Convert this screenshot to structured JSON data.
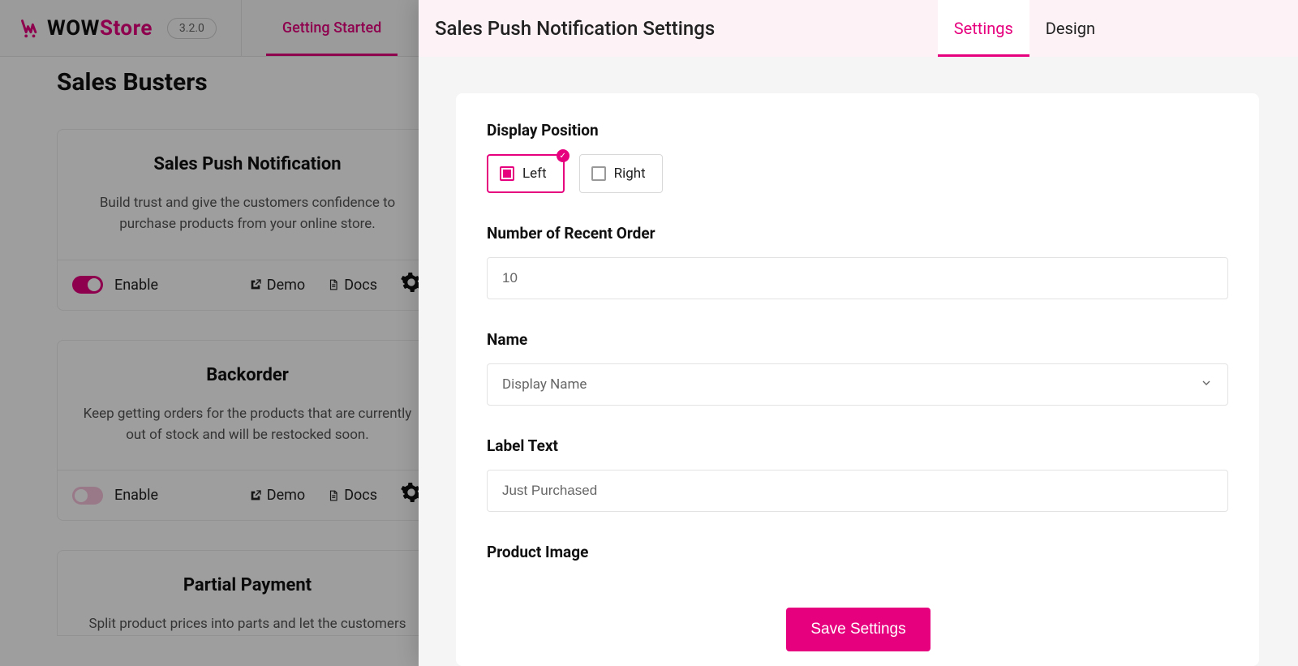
{
  "brand": {
    "wow": "WOW",
    "store": "Store",
    "version": "3.2.0"
  },
  "nav": {
    "getting_started": "Getting Started"
  },
  "page": {
    "title": "Sales Busters"
  },
  "cards": {
    "push": {
      "title": "Sales Push Notification",
      "desc": "Build trust and give the customers confidence to purchase products from your online store.",
      "enable": "Enable",
      "demo": "Demo",
      "docs": "Docs"
    },
    "backorder": {
      "title": "Backorder",
      "desc": "Keep getting orders for the products that are currently out of stock and will be restocked soon.",
      "enable": "Enable",
      "demo": "Demo",
      "docs": "Docs"
    },
    "partial": {
      "title": "Partial Payment",
      "desc": "Split product prices into parts and let the customers"
    }
  },
  "panel": {
    "title": "Sales Push Notification Settings",
    "tabs": {
      "settings": "Settings",
      "design": "Design"
    },
    "form": {
      "display_position": {
        "label": "Display Position",
        "left": "Left",
        "right": "Right",
        "selected": "left"
      },
      "recent_order": {
        "label": "Number of Recent Order",
        "value": "10"
      },
      "name": {
        "label": "Name",
        "value": "Display Name"
      },
      "label_text": {
        "label": "Label Text",
        "value": "Just Purchased"
      },
      "product_image": {
        "label": "Product Image"
      }
    },
    "save": "Save Settings"
  }
}
